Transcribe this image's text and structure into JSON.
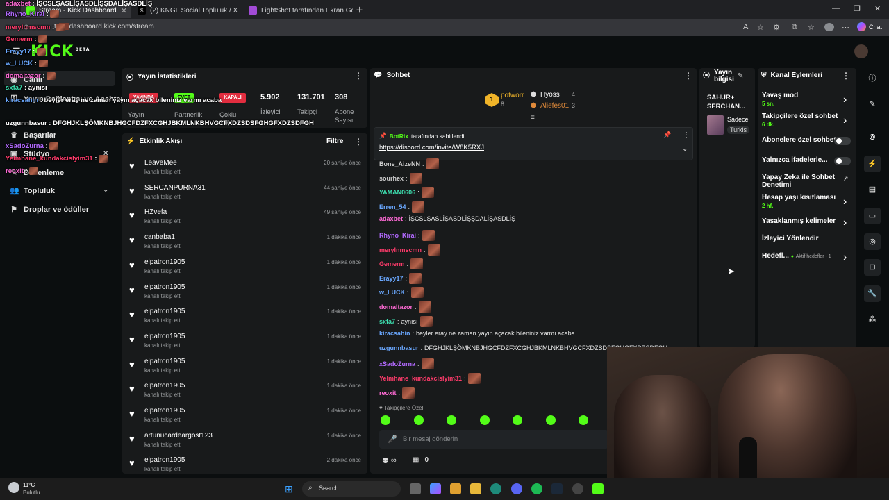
{
  "browser": {
    "tabs": [
      {
        "label": "Stream - Kick Dashboard",
        "active": true
      },
      {
        "label": "(2) KNGL Social Topluluk / X",
        "active": false
      },
      {
        "label": "LightShot tarafından Ekran Görünt",
        "active": false
      }
    ],
    "url": "dashboard.kick.com/stream",
    "url_prefix": "tt",
    "copilot_label": "Chat"
  },
  "brand": {
    "logo": "KICK",
    "beta": "BETA",
    "accent": "#53fc18"
  },
  "sidebar": {
    "items": [
      {
        "label": "Canlı",
        "icon": "broadcast-icon"
      },
      {
        "label": "Yayın Bağlantısı ve Anahtarı",
        "icon": "key-icon"
      },
      {
        "label": "Başarılar",
        "icon": "trophy-icon"
      },
      {
        "label": "Stüdyo",
        "icon": "studio-icon"
      },
      {
        "label": "Düzenleme",
        "icon": "edit-icon"
      },
      {
        "label": "Topluluk",
        "icon": "community-icon"
      },
      {
        "label": "Droplar ve ödüller",
        "icon": "gift-icon"
      }
    ]
  },
  "stats_panel": {
    "title": "Yayın İstatistikleri",
    "tags": [
      "YAYINDA",
      "EVET",
      "KAPALI"
    ],
    "tag_labels": [
      "Yayın",
      "Partnerlik",
      "Çoklu Yayın"
    ],
    "values": [
      {
        "value": "5.902",
        "label": "İzleyici"
      },
      {
        "value": "131.701",
        "label": "Takipçi"
      },
      {
        "value": "308",
        "label": "Abone Sayısı"
      }
    ]
  },
  "activity_panel": {
    "title": "Etkinlik Akışı",
    "filter_label": "Filtre",
    "rows": [
      {
        "name": "LeaveMee",
        "sub": "kanalı takip etti",
        "time": "20 saniye önce"
      },
      {
        "name": "SERCANPURNA31",
        "sub": "kanalı takip etti",
        "time": "44 saniye önce"
      },
      {
        "name": "HZvefa",
        "sub": "kanalı takip etti",
        "time": "49 saniye önce"
      },
      {
        "name": "canbaba1",
        "sub": "kanalı takip etti",
        "time": "1 dakika önce"
      },
      {
        "name": "elpatron1905",
        "sub": "kanalı takip etti",
        "time": "1 dakika önce"
      },
      {
        "name": "elpatron1905",
        "sub": "kanalı takip etti",
        "time": "1 dakika önce"
      },
      {
        "name": "elpatron1905",
        "sub": "kanalı takip etti",
        "time": "1 dakika önce"
      },
      {
        "name": "elpatron1905",
        "sub": "kanalı takip etti",
        "time": "1 dakika önce"
      },
      {
        "name": "elpatron1905",
        "sub": "kanalı takip etti",
        "time": "1 dakika önce"
      },
      {
        "name": "elpatron1905",
        "sub": "kanalı takip etti",
        "time": "1 dakika önce"
      },
      {
        "name": "elpatron1905",
        "sub": "kanalı takip etti",
        "time": "1 dakika önce"
      },
      {
        "name": "artunucardeargost123",
        "sub": "kanalı takip etti",
        "time": "1 dakika önce"
      },
      {
        "name": "elpatron1905",
        "sub": "kanalı takip etti",
        "time": "2 dakika önce"
      }
    ]
  },
  "chat_panel": {
    "title": "Sohbet",
    "leaders": [
      {
        "rank": "1",
        "name": "potworr",
        "count": "8"
      },
      {
        "name": "Hyoss",
        "count": "4"
      },
      {
        "name": "Aliefes01",
        "count": "3"
      }
    ],
    "pinned_by": "BotRix",
    "pinned_suffix": "tarafından sabitlendi",
    "pinned_link": "https://discord.com/invite/W8K5RXJ",
    "messages": [
      {
        "user": "Bone_AizeNN",
        "color": "#cfcfcf",
        "text": "",
        "emote": true
      },
      {
        "user": "sourhex",
        "color": "#cfcfcf",
        "text": "",
        "emote": true
      },
      {
        "user": "YAMAN0606",
        "color": "#3de0b0",
        "text": "",
        "emote": true
      },
      {
        "user": "Erren_54",
        "color": "#6aa8ff",
        "text": "",
        "emote": true
      },
      {
        "user": "adaxbet",
        "color": "#ff6ad5",
        "text": "İŞCSLŞASLİŞASDLİŞŞDALİŞASDLİŞ",
        "emote": false
      },
      {
        "user": "Rhyno_Kirai",
        "color": "#b36aff",
        "text": "",
        "emote": true
      },
      {
        "user": "merylnmscmn",
        "color": "#ff3b6b",
        "text": "",
        "emote": true
      },
      {
        "user": "Gemerm",
        "color": "#ff3b6b",
        "text": "",
        "emote": true
      },
      {
        "user": "Erayy17",
        "color": "#6aa8ff",
        "text": "",
        "emote": true
      },
      {
        "user": "w_LUCK",
        "color": "#6aa8ff",
        "text": "",
        "emote": true
      },
      {
        "user": "domaltazor",
        "color": "#ff6ad5",
        "text": "",
        "emote": true
      },
      {
        "user": "sxfa7",
        "color": "#3de0b0",
        "text": "aynısı",
        "emote": true
      },
      {
        "user": "kiracsahin",
        "color": "#6aa8ff",
        "text": "beyler eray ne zaman yayın açacak bileniniz varmı acaba",
        "emote": false
      },
      {
        "user": "uzgunnbasur",
        "color": "#6aa8ff",
        "text": "DFGHJKLŞÖMKNBJHGCFDZFXCGHJBKMLNKBHVGCFXDZSDSFGHGFXDZSDFGH",
        "emote": false
      },
      {
        "user": "xSadoZurna",
        "color": "#b36aff",
        "text": "",
        "emote": true
      },
      {
        "user": "Yelmhane_kundakcislyim31",
        "color": "#ff3b6b",
        "text": "",
        "emote": true
      },
      {
        "user": "reoxit",
        "color": "#ff6ad5",
        "text": "",
        "emote": true
      }
    ],
    "followers_only": "Takipçilere Özel",
    "input_placeholder": "Bir mesaj gönderin",
    "bottom_count": "0",
    "infinity": "∞"
  },
  "info_panel": {
    "title": "Yayın bilgisi",
    "stream_title": "SAHUR+ SERCHAN...",
    "category": "Sadece",
    "language": "Turkis"
  },
  "actions_panel": {
    "title": "Kanal Eylemleri",
    "items": [
      {
        "label": "Yavaş mod",
        "sub": "5 sn.",
        "control": "chevron"
      },
      {
        "label": "Takipçilere özel sohbet",
        "sub": "6 dk.",
        "control": "chevron"
      },
      {
        "label": "Abonelere özel sohbet",
        "sub": "",
        "control": "toggle"
      },
      {
        "label": "Yalnızca ifadelerle...",
        "sub": "",
        "control": "toggle"
      },
      {
        "label": "Yapay Zeka ile Sohbet Denetimi",
        "sub": "",
        "control": "external"
      },
      {
        "label": "Hesap yaşı kısıtlaması",
        "sub": "2 hf.",
        "control": "chevron"
      },
      {
        "label": "Yasaklanmış kelimeler",
        "sub": "",
        "control": "chevron"
      },
      {
        "label": "İzleyici Yönlendir",
        "sub": "",
        "control": "none"
      },
      {
        "label": "Hedefl...",
        "sub": "Aktif hedefler - 1",
        "control": "chevron"
      }
    ]
  },
  "overlay_chat": [
    {
      "user": "adaxbet",
      "text": "İŞCSLŞASLİŞASDLİŞŞDALİŞASDLİŞ",
      "color": "#ff6ad5"
    },
    {
      "user": "Rhyno_Kirai",
      "text": "",
      "color": "#b36aff"
    },
    {
      "user": "merylnmscmn",
      "text": "",
      "color": "#ff3b6b"
    },
    {
      "user": "Gemerm",
      "text": "",
      "color": "#ff3b6b"
    },
    {
      "user": "Erayy17",
      "text": "",
      "color": "#6aa8ff"
    },
    {
      "user": "w_LUCK",
      "text": "",
      "color": "#6aa8ff"
    },
    {
      "user": "domaltazor",
      "text": "",
      "color": "#ff6ad5"
    },
    {
      "user": "sxfa7",
      "text": "aynısı",
      "color": "#3de0b0"
    },
    {
      "user": "kiracsahin",
      "text": "beyler eray ne zaman yayın açacak bileniniz varmı acaba",
      "color": "#6aa8ff"
    },
    {
      "user": "uzgunnbasur",
      "text": "DFGHJKLŞÖMKNBJHGCFDZFXCGHJBKMLNKBHVGCFXDZSDSFGHGFXDZSDFGH",
      "color": "#ffffff"
    },
    {
      "user": "xSadoZurna",
      "text": "",
      "color": "#b36aff"
    },
    {
      "user": "Yelmhane_kundakcislyim31",
      "text": "",
      "color": "#ff3b6b"
    },
    {
      "user": "reoxit",
      "text": "",
      "color": "#ff6ad5"
    }
  ],
  "taskbar": {
    "weather_temp": "11°C",
    "weather_desc": "Bulutlu",
    "search_label": "Search"
  }
}
